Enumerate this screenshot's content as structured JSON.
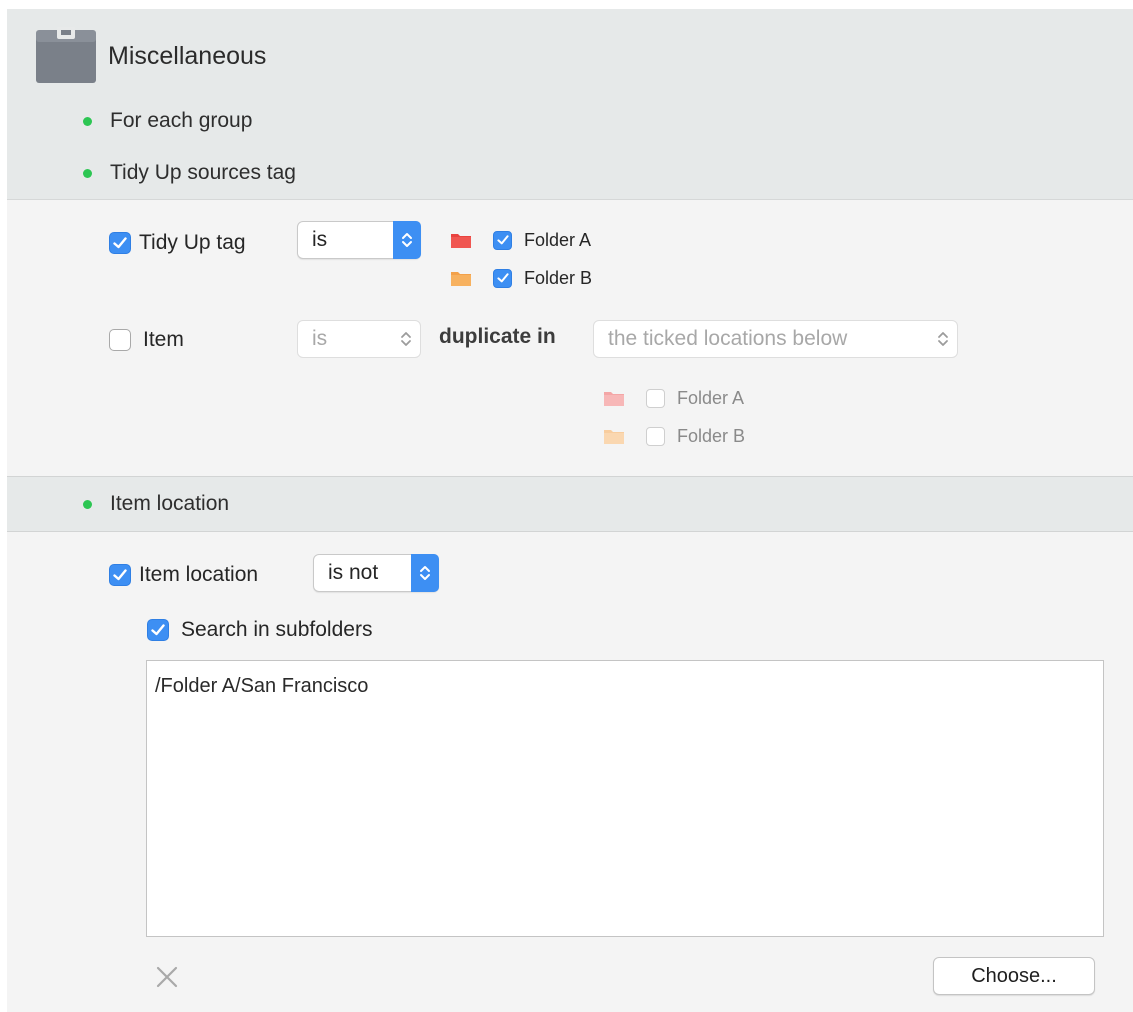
{
  "header": {
    "title": "Miscellaneous",
    "items": [
      "For each group",
      "Tidy Up sources tag"
    ]
  },
  "tag_condition": {
    "checked": true,
    "label": "Tidy Up tag",
    "operator": "is",
    "folders": [
      {
        "label": "Folder A",
        "color": "#e9433f",
        "checked": true
      },
      {
        "label": "Folder B",
        "color": "#f3a14a",
        "checked": true
      }
    ]
  },
  "item_condition": {
    "checked": false,
    "label": "Item",
    "operator": "is",
    "middle_text": "duplicate in",
    "scope": "the ticked locations below",
    "folders": [
      {
        "label": "Folder A",
        "color": "#f4a6a6",
        "checked": false
      },
      {
        "label": "Folder B",
        "color": "#f8cd9e",
        "checked": false
      }
    ]
  },
  "location_section": {
    "title": "Item location"
  },
  "location_condition": {
    "checked": true,
    "label": "Item location",
    "operator": "is not",
    "subfolders_checked": true,
    "subfolders_label": "Search in subfolders",
    "paths": "/Folder A/San Francisco",
    "choose_label": "Choose..."
  },
  "icons": {
    "header": "box-icon",
    "remove": "close-icon",
    "folder": "folder-icon",
    "popup": "up-down-chevrons-icon"
  },
  "colors": {
    "accent": "#3d8ff3",
    "bullet": "#2dc653",
    "band": "#e6e9e9"
  }
}
